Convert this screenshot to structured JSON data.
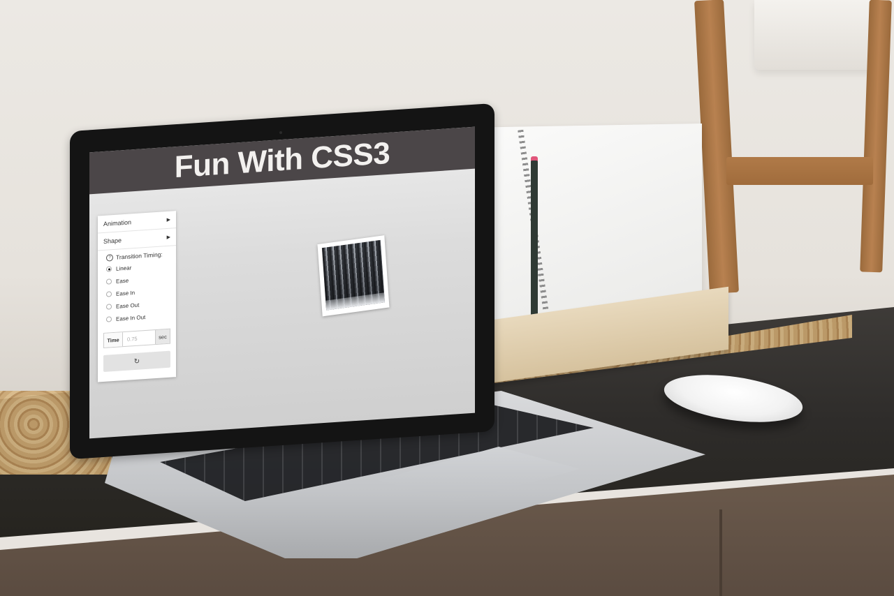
{
  "banner": {
    "title": "Fun With CSS3"
  },
  "panel": {
    "menus": [
      {
        "label": "Animation",
        "icon": "caret-right-icon"
      },
      {
        "label": "Shape",
        "icon": "caret-right-icon"
      }
    ],
    "timing_heading": "Transition Timing:",
    "help_icon": "?",
    "options": [
      {
        "label": "Linear",
        "selected": true
      },
      {
        "label": "Ease",
        "selected": false
      },
      {
        "label": "Ease In",
        "selected": false
      },
      {
        "label": "Ease Out",
        "selected": false
      },
      {
        "label": "Ease In Out",
        "selected": false
      }
    ],
    "time": {
      "label": "Time",
      "placeholder": "0.75",
      "unit": "sec"
    },
    "reset_icon": "↻"
  },
  "colors": {
    "banner_bg": "#4b4648",
    "banner_text": "#f3f1ef",
    "reset_button": "#e2e2e2"
  }
}
